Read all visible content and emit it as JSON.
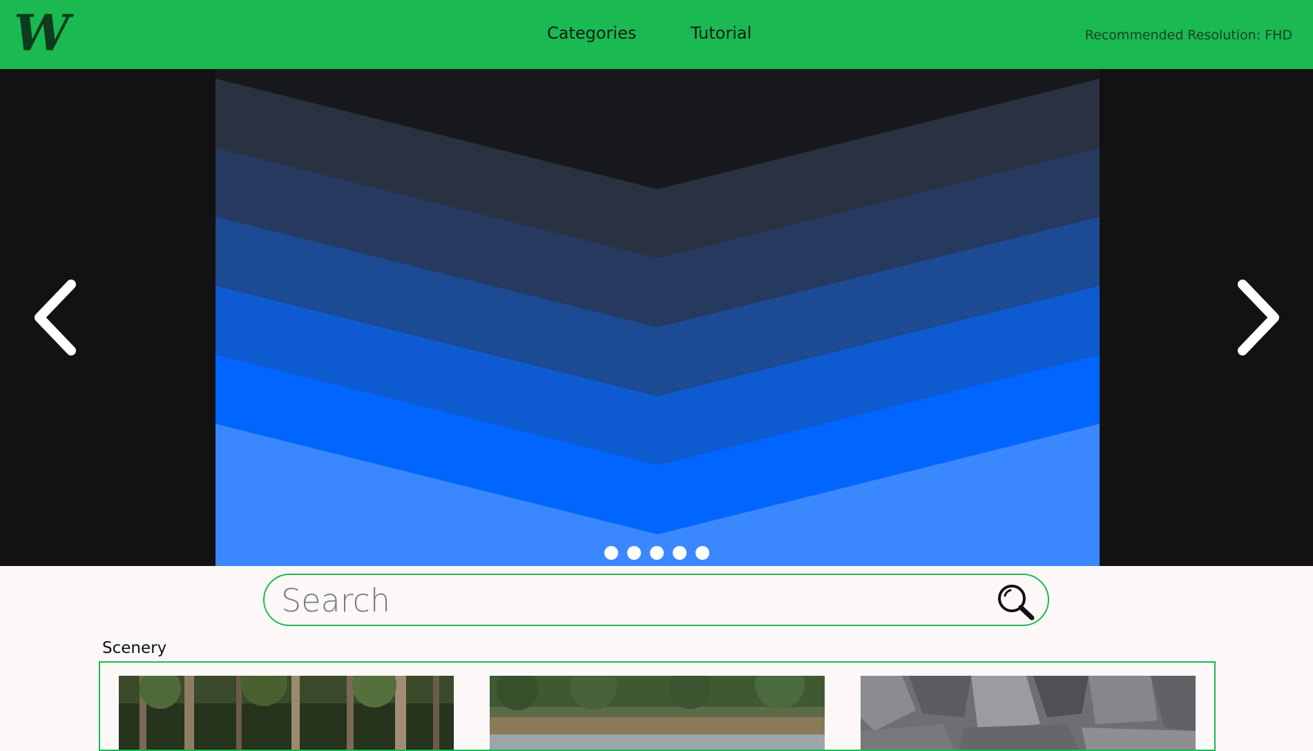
{
  "header": {
    "logo_letter": "W",
    "nav": {
      "categories": "Categories",
      "tutorial": "Tutorial"
    },
    "resolution_note": "Recommended Resolution: FHD"
  },
  "carousel": {
    "prev_icon": "chevron-left-icon",
    "next_icon": "chevron-right-icon",
    "dot_count": 5,
    "stripe_colors": [
      "#2a3242",
      "#26395f",
      "#1c4a93",
      "#0e5ad0",
      "#0066ff",
      "#3a87ff"
    ]
  },
  "search": {
    "placeholder": "Search",
    "icon": "search-icon"
  },
  "gallery": {
    "section_label": "Scenery",
    "items": [
      "forest-photo",
      "river-photo",
      "rocks-photo"
    ]
  },
  "colors": {
    "accent": "#1ab951",
    "page_bg": "#fbf8f7",
    "carousel_bg": "#121212"
  }
}
